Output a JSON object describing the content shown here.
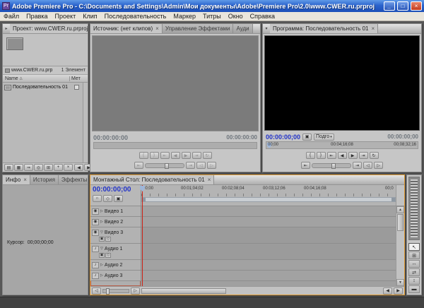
{
  "titlebar": {
    "title": "Adobe Premiere Pro - C:\\Documents and Settings\\Admin\\Мои документы\\Adobe\\Premiere Pro\\2.0\\www.CWER.ru.prproj"
  },
  "menubar": {
    "items": [
      "Файл",
      "Правка",
      "Проект",
      "Клип",
      "Последовательность",
      "Маркер",
      "Титры",
      "Окно",
      "Справка"
    ]
  },
  "project": {
    "tab": "Проект: www.CWER.ru.prproj",
    "file_name": "www.CWER.ru.prp",
    "item_count": "1 Элемент",
    "col_name": "Name",
    "col_meta": "Мет",
    "item_label": "Последовательность 01"
  },
  "source": {
    "tab_source": "Источник: (нет клипов)",
    "tab_effects": "Управление Эффектами",
    "tab_audio": "Ауди",
    "tc_left": "00:00:00:00",
    "tc_right": "00:00:00:00"
  },
  "program": {
    "tab": "Программа: Последовательность 01",
    "tc_left": "00:00:00;00",
    "fit": "Подго",
    "tc_right": "00:00:00;00",
    "ruler": [
      "00;00",
      "00:04;16;08",
      "00;08;32;16"
    ]
  },
  "timeline": {
    "tab": "Монтажный Стол: Последовательность 01",
    "tc": "00:00:00;00",
    "ruler": [
      "00;00",
      "00:01;04;02",
      "00:02;08;04",
      "00:03;12;06",
      "00:04;16;08",
      "00;0"
    ],
    "tracks": {
      "video": [
        "Видео 3",
        "Видео 2",
        "Видео 1"
      ],
      "audio": [
        "Аудио 1",
        "Аудио 2",
        "Аудио 3"
      ]
    }
  },
  "info": {
    "tab_info": "Инфо",
    "tab_history": "История",
    "tab_effects": "Эффекты",
    "cursor_label": "Курсор:",
    "cursor_value": "00;00;00;00"
  },
  "transport": {
    "row1": [
      "{",
      "}",
      "⇤",
      "◀",
      "▶",
      "⇥",
      "↻"
    ],
    "row2": [
      "⇤",
      "⇥",
      "◁",
      "▷"
    ]
  },
  "icons": {
    "app_badge": "Pr",
    "minimize": "_",
    "maximize": "□",
    "close": "×",
    "tab_close": "×",
    "chevron_right": "▸",
    "chevron_down": "▾",
    "dropdown": "▾",
    "sort_asc": "△",
    "eye": "◉",
    "speaker": "♪",
    "expand_open": "▽",
    "expand_closed": "▷",
    "list_view": "▤",
    "icon_view": "▦",
    "automate": "⇒",
    "find": "◎",
    "new_bin": "⊞",
    "new_item": "+",
    "delete": "×",
    "snap": "∩",
    "marker": "◇",
    "display_style": "▣",
    "scroll_up": "▲",
    "scroll_down": "▼",
    "scroll_left": "◀",
    "scroll_right": "▶",
    "zoom_out": "◁",
    "zoom_in": "▷"
  },
  "tools": [
    "↖",
    "⊞",
    "↔",
    "⇄",
    "↕",
    "▬"
  ],
  "colors": {
    "accent_orange": "#e09a30",
    "timecode_blue": "#2233c8",
    "cti_red": "#cc2418",
    "titlebar_blue": "#2b63cc"
  }
}
